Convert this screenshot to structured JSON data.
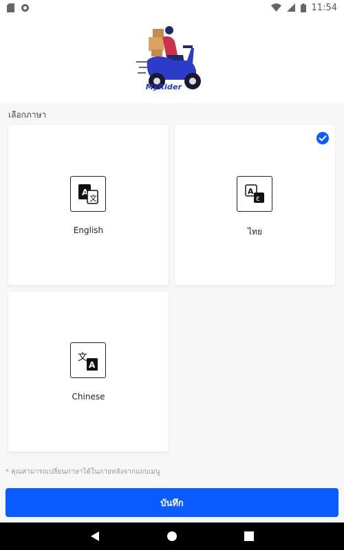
{
  "status_bar": {
    "time": "11:54",
    "icons": [
      "sd-card-icon",
      "sync-icon",
      "wifi-icon",
      "signal-icon",
      "battery-icon"
    ]
  },
  "header": {
    "brand": "MyRider",
    "logo_icon": "scooter-delivery-icon"
  },
  "language_section": {
    "label": "เลือกภาษา",
    "options": [
      {
        "label": "English",
        "icon": "translate-a-icon",
        "selected": false
      },
      {
        "label": "ไทย",
        "icon": "translate-thai-icon",
        "selected": true
      },
      {
        "label": "Chinese",
        "icon": "translate-chinese-icon",
        "selected": false
      }
    ]
  },
  "hint": "* คุณสามารถเปลี่ยนภาษาได้ในภายหลังจากแถบเมนู",
  "save_button": {
    "label": "บันทึก"
  },
  "colors": {
    "accent": "#0b5cff",
    "brand": "#1a3ad1",
    "background": "#f7f7f7"
  }
}
